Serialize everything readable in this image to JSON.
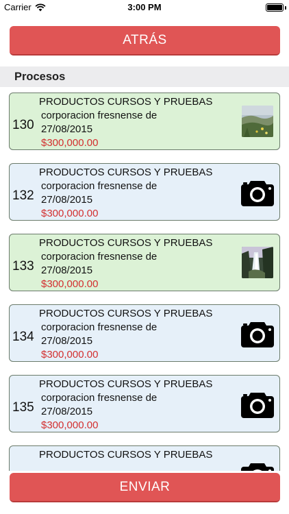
{
  "status_bar": {
    "carrier": "Carrier",
    "time": "3:00 PM",
    "battery_level": 1.0
  },
  "header": {
    "back_label": "ATRÁS"
  },
  "section": {
    "title": "Procesos"
  },
  "items": [
    {
      "number": "130",
      "title": "PRODUCTOS CURSOS Y PRUEBAS",
      "company": "corporacion fresnense de",
      "date": "27/08/2015",
      "amount": "$300,000.00",
      "status": "green",
      "media": "photo-thumbnail-meadow"
    },
    {
      "number": "132",
      "title": "PRODUCTOS CURSOS Y PRUEBAS",
      "company": "corporacion fresnense de",
      "date": "27/08/2015",
      "amount": "$300,000.00",
      "status": "blue",
      "media": "camera-icon"
    },
    {
      "number": "133",
      "title": "PRODUCTOS CURSOS Y PRUEBAS",
      "company": "corporacion fresnense de",
      "date": "27/08/2015",
      "amount": "$300,000.00",
      "status": "green",
      "media": "photo-thumbnail-waterfall"
    },
    {
      "number": "134",
      "title": "PRODUCTOS CURSOS Y PRUEBAS",
      "company": "corporacion fresnense de",
      "date": "27/08/2015",
      "amount": "$300,000.00",
      "status": "blue",
      "media": "camera-icon"
    },
    {
      "number": "135",
      "title": "PRODUCTOS CURSOS Y PRUEBAS",
      "company": "corporacion fresnense de",
      "date": "27/08/2015",
      "amount": "$300,000.00",
      "status": "blue",
      "media": "camera-icon"
    },
    {
      "number": "",
      "title": "PRODUCTOS CURSOS Y PRUEBAS",
      "company": "",
      "date": "",
      "amount": "",
      "status": "blue",
      "media": "camera-icon"
    }
  ],
  "footer": {
    "send_label": "ENVIAR"
  },
  "colors": {
    "button_red": "#e05555",
    "card_green": "#dcf2d6",
    "card_blue": "#e6f0f9",
    "amount_red": "#d32f2f"
  }
}
